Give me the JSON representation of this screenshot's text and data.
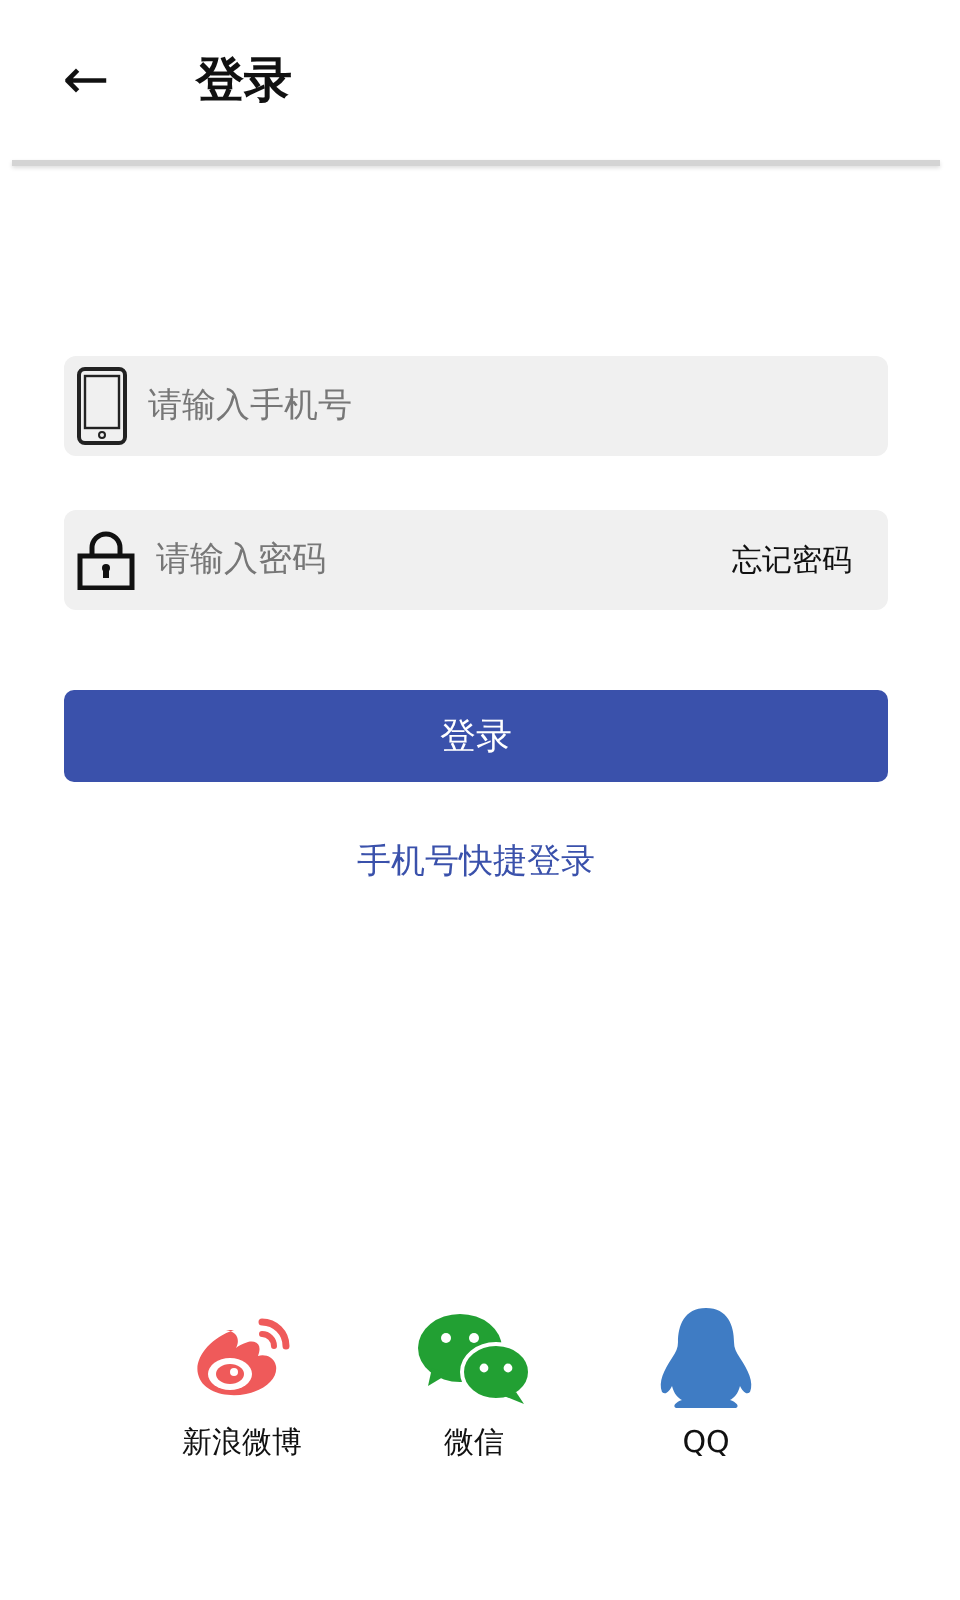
{
  "header": {
    "back_icon": "←",
    "title": "登录"
  },
  "phone_field": {
    "placeholder": "请输入手机号"
  },
  "password_field": {
    "placeholder": "请输入密码",
    "action": "忘记密码"
  },
  "login_button": "登录",
  "quick_login_link": "手机号快捷登录",
  "social_logins": [
    {
      "kind": "weibo",
      "label": "新浪微博"
    },
    {
      "kind": "wechat",
      "label": "微信"
    },
    {
      "kind": "qq",
      "label": "QQ"
    }
  ]
}
